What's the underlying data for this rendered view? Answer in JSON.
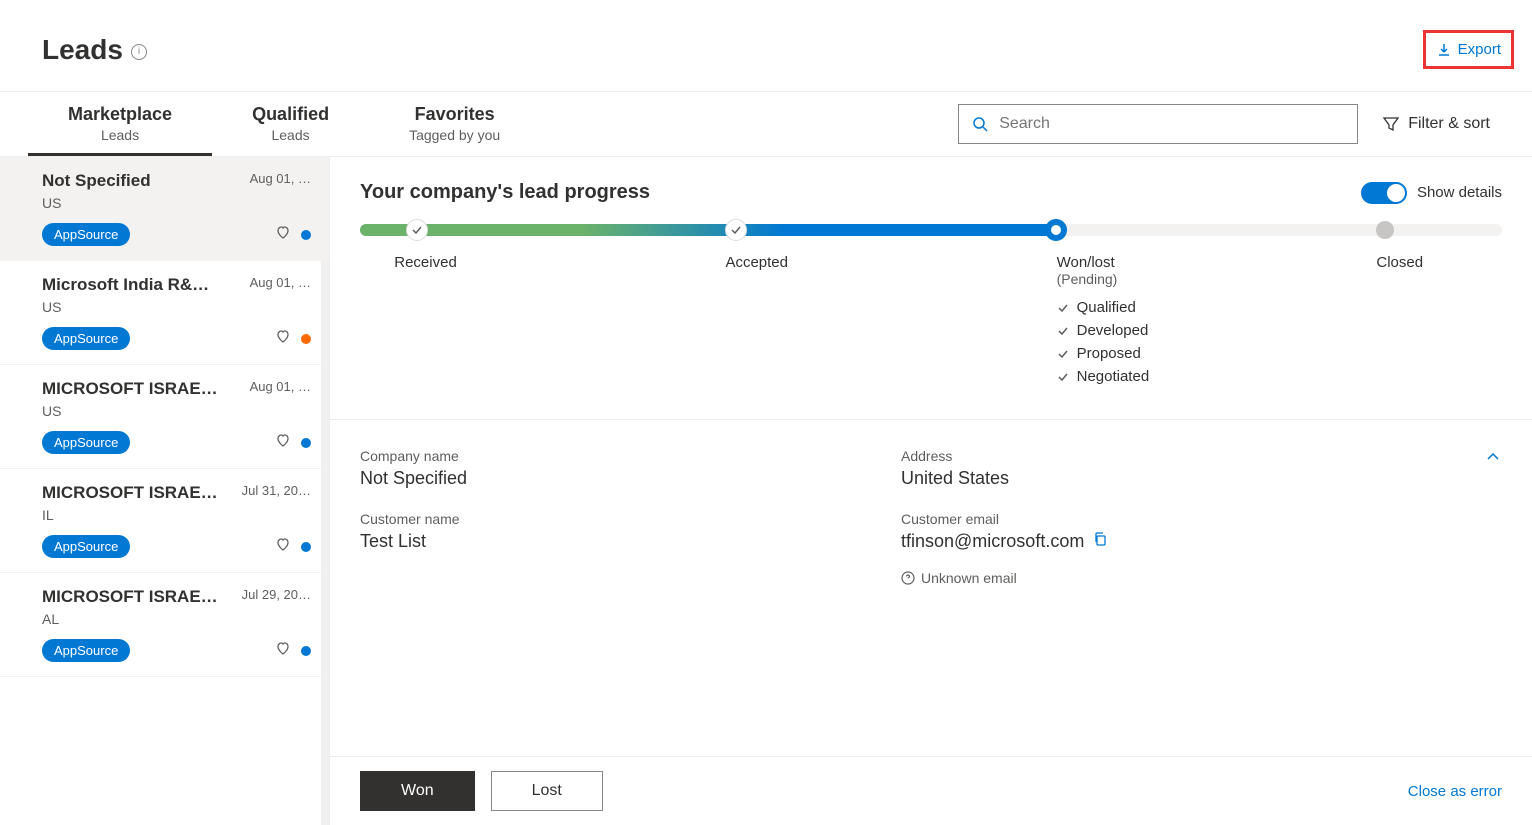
{
  "header": {
    "title": "Leads",
    "export_label": "Export"
  },
  "tabs": [
    {
      "title": "Marketplace",
      "subtitle": "Leads",
      "active": true
    },
    {
      "title": "Qualified",
      "subtitle": "Leads",
      "active": false
    },
    {
      "title": "Favorites",
      "subtitle": "Tagged by you",
      "active": false
    }
  ],
  "search": {
    "placeholder": "Search"
  },
  "filter_sort_label": "Filter & sort",
  "leads": [
    {
      "title": "Not Specified",
      "date": "Aug 01, …",
      "sub": "US",
      "badge": "AppSource",
      "dot": "blue",
      "selected": true
    },
    {
      "title": "Microsoft India R&…",
      "date": "Aug 01, …",
      "sub": "US",
      "badge": "AppSource",
      "dot": "orange",
      "selected": false
    },
    {
      "title": "MICROSOFT ISRAE…",
      "date": "Aug 01, …",
      "sub": "US",
      "badge": "AppSource",
      "dot": "blue",
      "selected": false
    },
    {
      "title": "MICROSOFT ISRAE…",
      "date": "Jul 31, 20…",
      "sub": "IL",
      "badge": "AppSource",
      "dot": "blue",
      "selected": false
    },
    {
      "title": "MICROSOFT ISRAE…",
      "date": "Jul 29, 20…",
      "sub": "AL",
      "badge": "AppSource",
      "dot": "blue",
      "selected": false
    }
  ],
  "detail": {
    "progress_title": "Your company's lead progress",
    "show_details_label": "Show details",
    "stages": {
      "received": "Received",
      "accepted": "Accepted",
      "wonlost": "Won/lost",
      "wonlost_sub": "(Pending)",
      "closed": "Closed"
    },
    "checklist": [
      "Qualified",
      "Developed",
      "Proposed",
      "Negotiated"
    ],
    "fields": {
      "company_name_label": "Company name",
      "company_name_value": "Not Specified",
      "address_label": "Address",
      "address_value": "United States",
      "customer_name_label": "Customer name",
      "customer_name_value": "Test List",
      "customer_email_label": "Customer email",
      "customer_email_value": "tfinson@microsoft.com",
      "email_meta": "Unknown email"
    },
    "actions": {
      "won": "Won",
      "lost": "Lost",
      "close_error": "Close as error"
    }
  }
}
